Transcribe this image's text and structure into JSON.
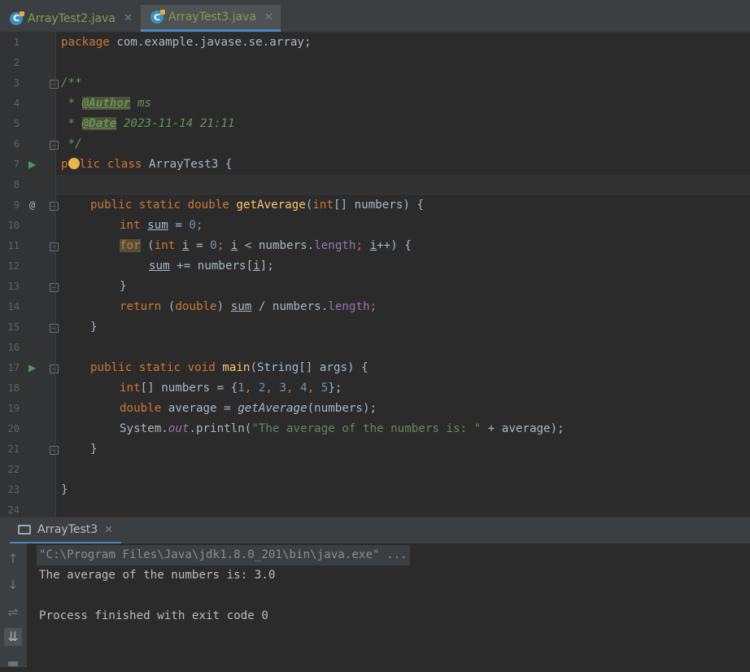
{
  "tabs": [
    {
      "label": "ArrayTest2.java",
      "icon": "java-class-icon"
    },
    {
      "label": "ArrayTest3.java",
      "icon": "java-class-icon"
    }
  ],
  "close_glyph": "✕",
  "editor": {
    "line_numbers": [
      "1",
      "2",
      "3",
      "4",
      "5",
      "6",
      "7",
      "8",
      "9",
      "10",
      "11",
      "12",
      "13",
      "14",
      "15",
      "16",
      "17",
      "18",
      "19",
      "20",
      "21",
      "22",
      "23",
      "24"
    ],
    "lines": {
      "l1": {
        "kw": "package",
        "rest": " com.example.javase.se.array;"
      },
      "l3": "/**",
      "l4": {
        "star": " * ",
        "tag": "@Author",
        "val": " ms"
      },
      "l5": {
        "star": " * ",
        "tag": "@Date",
        "val": " 2023-11-14 21:11"
      },
      "l6": " */",
      "l7": {
        "p": "p",
        "rest_kw": "lic class",
        "rest": " ArrayTest3 {"
      },
      "l9": {
        "kw": "public static double",
        "meth": " getAverage",
        "open": "(",
        "kw2": "int",
        "rest": "[] numbers) {"
      },
      "l10": {
        "kw": "int",
        "var": "sum",
        "eq": " = ",
        "num": "0",
        "semi": ";"
      },
      "l11": {
        "kw": "for",
        "p1": " (",
        "kw2": "int",
        "i1": "i",
        "p2": " = ",
        "num": "0",
        "semi1": "; ",
        "i2": "i",
        "p3": " < numbers.",
        "fld": "length",
        "semi2": "; ",
        "i3": "i",
        "p4": "++) {"
      },
      "l12": {
        "var": "sum",
        "p1": " += numbers[",
        "i": "i",
        "p2": "];"
      },
      "l13": "}",
      "l14": {
        "kw": "return",
        "p1": " (",
        "kw2": "double",
        "p2": ") ",
        "var": "sum",
        "p3": " / numbers.",
        "fld": "length",
        "semi": ";"
      },
      "l15": "}",
      "l17": {
        "kw": "public static void",
        "meth": " main",
        "rest": "(String[] args) {"
      },
      "l18": {
        "kw": "int",
        "p1": "[] numbers = {",
        "n1": "1",
        "c1": ", ",
        "n2": "2",
        "c2": ", ",
        "n3": "3",
        "c3": ", ",
        "n4": "4",
        "c4": ", ",
        "n5": "5",
        "p2": "};"
      },
      "l19": {
        "kw": "double",
        "p1": " average = ",
        "it": "getAverage",
        "p2": "(numbers);"
      },
      "l20": {
        "p1": "System.",
        "sfld": "out",
        "p2": ".println(",
        "str": "\"The average of the numbers is: \"",
        "p3": " + average);"
      },
      "l21": "}",
      "l23": "}"
    },
    "gutter_marks": {
      "run": "▶",
      "override": "@",
      "fold": "−"
    }
  },
  "console": {
    "tab_label": "ArrayTest3",
    "command": "\"C:\\Program Files\\Java\\jdk1.8.0_201\\bin\\java.exe\" ...",
    "output": "The average of the numbers is: 3.0",
    "exit": "Process finished with exit code 0",
    "toolbar": [
      "↑",
      "↓",
      "⇌",
      "⇊",
      "▬"
    ]
  }
}
